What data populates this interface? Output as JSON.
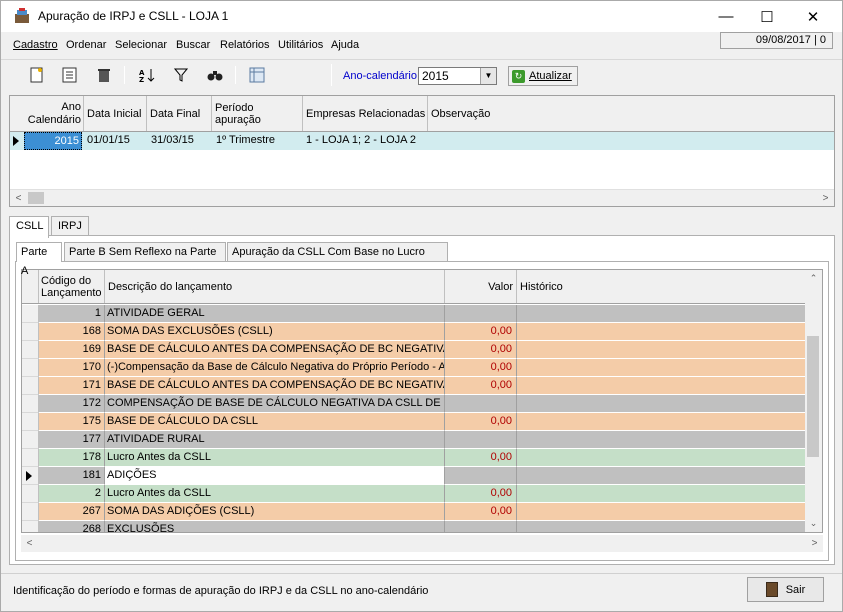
{
  "window": {
    "title": "Apuração de IRPJ e CSLL - LOJA 1",
    "minimize": "—",
    "maximize": "☐",
    "close": "✕"
  },
  "menu": [
    "Cadastro",
    "Ordenar",
    "Selecionar",
    "Buscar",
    "Relatórios",
    "Utilitários",
    "Ajuda"
  ],
  "date_box": "09/08/2017 | 0",
  "toolbar": {
    "ano_label": "Ano-calendário",
    "ano_value": "2015",
    "atualizar_label": "Atualizar",
    "icons": [
      "new-icon",
      "edit-icon",
      "delete-icon",
      "sort-icon",
      "filter-icon",
      "find-icon",
      "report-icon"
    ]
  },
  "top_grid": {
    "headers": [
      "Ano\nCalendário",
      "Data Inicial",
      "Data Final",
      "Período apuração",
      "Empresas Relacionadas",
      "Observação"
    ],
    "rows": [
      {
        "ano": "2015",
        "data_inicial": "01/01/15",
        "data_final": "31/03/15",
        "periodo": "1º Trimestre",
        "empresas": "1 - LOJA 1; 2 - LOJA 2",
        "obs": ""
      }
    ]
  },
  "tabs": [
    "CSLL",
    "IRPJ"
  ],
  "subtabs": [
    "Parte A",
    "Parte B Sem Reflexo na Parte A",
    "Apuração da CSLL Com Base no Lucro Real"
  ],
  "lanc_grid": {
    "headers": {
      "codigo": "Código do\nLançamento",
      "descricao": "Descrição do lançamento",
      "valor": "Valor",
      "historico": "Histórico"
    },
    "rows": [
      {
        "cod": "1",
        "desc": "ATIVIDADE GERAL",
        "val": "",
        "type": "gray"
      },
      {
        "cod": "168",
        "desc": "SOMA DAS EXCLUSÕES (CSLL)",
        "val": "0,00",
        "type": "orange"
      },
      {
        "cod": "169",
        "desc": "BASE DE CÁLCULO ANTES DA COMPENSAÇÃO DE BC NEGATIVA D",
        "val": "0,00",
        "type": "orange"
      },
      {
        "cod": "170",
        "desc": "(-)Compensação da Base de Cálculo Negativa do Próprio Período - Ativ",
        "val": "0,00",
        "type": "orange"
      },
      {
        "cod": "171",
        "desc": "BASE DE CÁLCULO ANTES DA COMPENSAÇÃO DE BC NEGATIVA D",
        "val": "0,00",
        "type": "orange"
      },
      {
        "cod": "172",
        "desc": "COMPENSAÇÃO DE BASE DE CÁLCULO NEGATIVA DA CSLL DE PE",
        "val": "",
        "type": "gray"
      },
      {
        "cod": "175",
        "desc": "BASE DE CÁLCULO DA CSLL",
        "val": "0,00",
        "type": "orange"
      },
      {
        "cod": "177",
        "desc": "ATIVIDADE RURAL",
        "val": "",
        "type": "gray"
      },
      {
        "cod": "178",
        "desc": "Lucro Antes da CSLL",
        "val": "0,00",
        "type": "green"
      },
      {
        "cod": "181",
        "desc": "ADIÇÕES",
        "val": "",
        "type": "selected"
      },
      {
        "cod": "2",
        "desc": "Lucro Antes da CSLL",
        "val": "0,00",
        "type": "green"
      },
      {
        "cod": "267",
        "desc": "SOMA DAS ADIÇÕES (CSLL)",
        "val": "0,00",
        "type": "orange"
      },
      {
        "cod": "268",
        "desc": "EXCLUSÕES",
        "val": "",
        "type": "gray"
      }
    ]
  },
  "colors": {
    "gray": "#c0c0c0",
    "orange": "#f4cca8",
    "green": "#c5dfc8",
    "selected": "#ffffff",
    "value_red": "#b00000",
    "selection_blue": "#3c8fd4"
  },
  "status": {
    "text": "Identificação do período e formas de apuração do IRPJ e da CSLL no ano-calendário",
    "sair_label": "Sair"
  }
}
